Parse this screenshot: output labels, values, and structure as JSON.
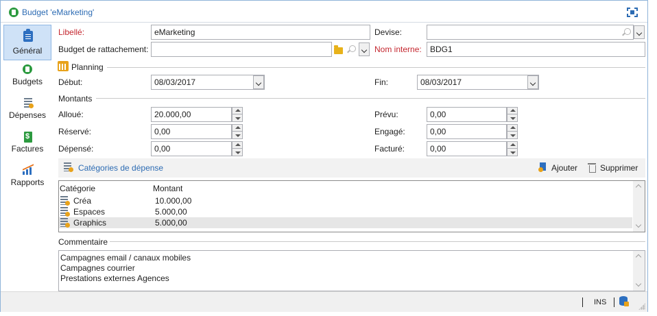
{
  "window": {
    "title": "Budget 'eMarketing'",
    "icon": "budget-icon",
    "maximize_icon": "fullscreen-icon"
  },
  "sidebar": {
    "items": [
      {
        "label": "Général",
        "icon": "clipboard-icon",
        "active": true
      },
      {
        "label": "Budgets",
        "icon": "money-icon",
        "active": false
      },
      {
        "label": "Dépenses",
        "icon": "expense-list-icon",
        "active": false
      },
      {
        "label": "Factures",
        "icon": "invoice-icon",
        "active": false
      },
      {
        "label": "Rapports",
        "icon": "chart-icon",
        "active": false
      }
    ]
  },
  "form": {
    "libelle": {
      "label": "Libellé:",
      "value": "eMarketing"
    },
    "devise": {
      "label": "Devise:",
      "value": ""
    },
    "budget_rattachement": {
      "label": "Budget de rattachement:",
      "value": ""
    },
    "nom_interne": {
      "label": "Nom interne:",
      "value": "BDG1"
    }
  },
  "planning": {
    "title": "Planning",
    "debut": {
      "label": "Début:",
      "value": "08/03/2017"
    },
    "fin": {
      "label": "Fin:",
      "value": "08/03/2017"
    }
  },
  "montants": {
    "title": "Montants",
    "alloue": {
      "label": "Alloué:",
      "value": "20.000,00"
    },
    "reserve": {
      "label": "Réservé:",
      "value": "0,00"
    },
    "depense": {
      "label": "Dépensé:",
      "value": "0,00"
    },
    "prevu": {
      "label": "Prévu:",
      "value": "0,00"
    },
    "engage": {
      "label": "Engagé:",
      "value": "0,00"
    },
    "facture": {
      "label": "Facturé:",
      "value": "0,00"
    }
  },
  "categories": {
    "title": "Catégories de dépense",
    "add_label": "Ajouter",
    "delete_label": "Supprimer",
    "columns": [
      "Catégorie",
      "Montant"
    ],
    "rows": [
      {
        "categorie": "Créa",
        "montant": "10.000,00",
        "selected": false
      },
      {
        "categorie": "Espaces",
        "montant": "5.000,00",
        "selected": false
      },
      {
        "categorie": "Graphics",
        "montant": "5.000,00",
        "selected": true
      }
    ]
  },
  "commentaire": {
    "title": "Commentaire",
    "lines": [
      "Campagnes email / canaux mobiles",
      "Campagnes courrier",
      "Prestations externes Agences"
    ]
  },
  "statusbar": {
    "mode": "INS"
  },
  "colors": {
    "accent": "#2c6bb3",
    "required_label": "#c4262e",
    "active_tab_bg": "#cfe2f7",
    "selected_row": "#e6e6e6"
  }
}
